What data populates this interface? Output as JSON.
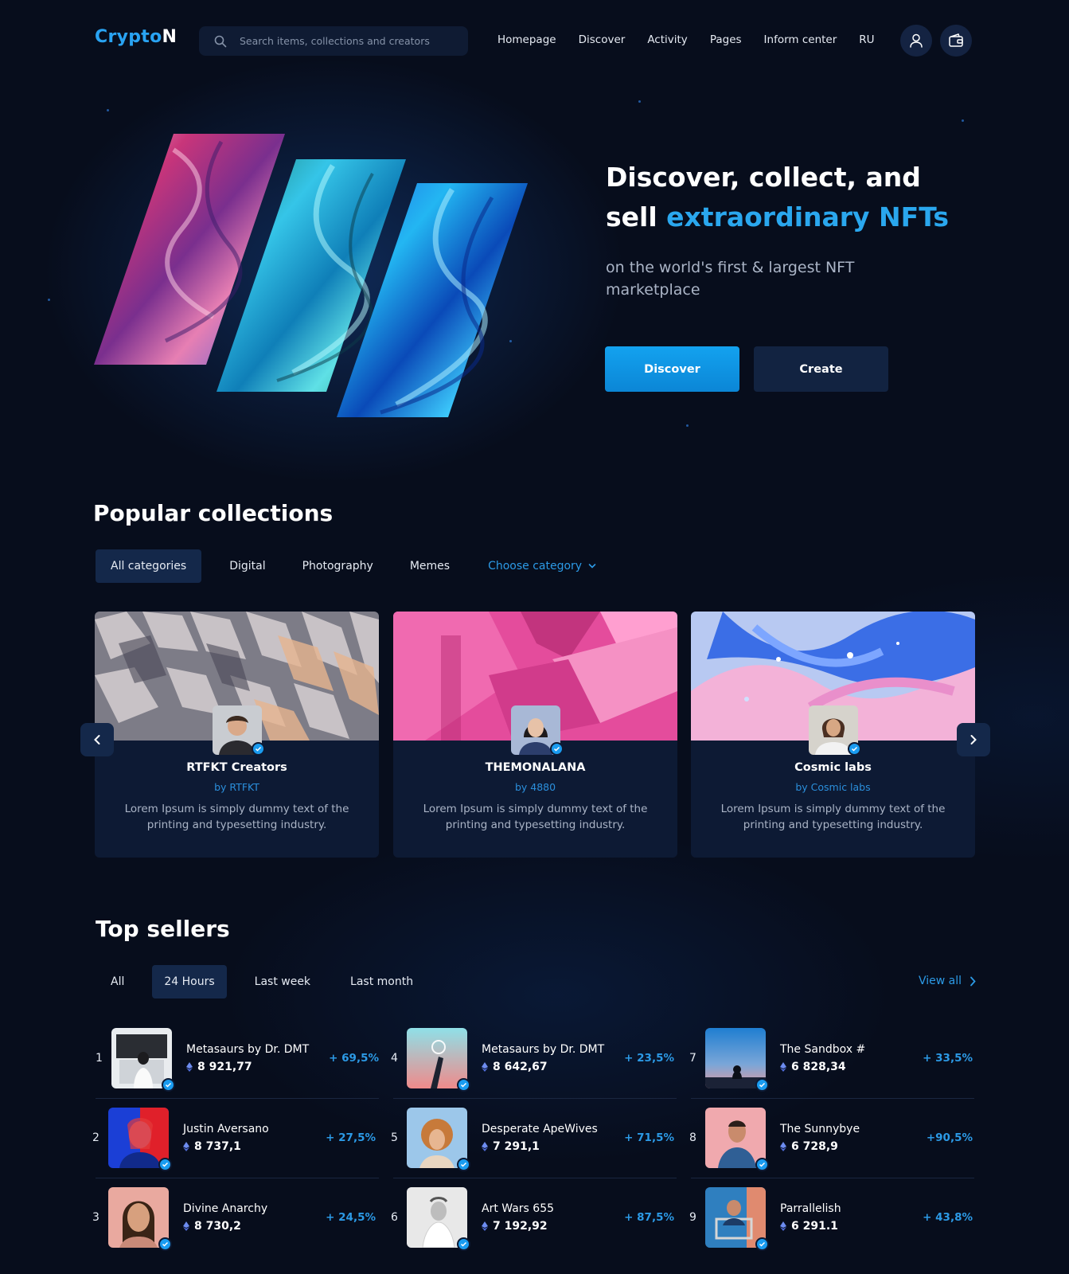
{
  "header": {
    "logo_main": "Crypto",
    "logo_end": "N",
    "search_placeholder": "Search items, collections and creators",
    "nav": [
      "Homepage",
      "Discover",
      "Activity",
      "Pages",
      "Inform center",
      "RU"
    ]
  },
  "hero": {
    "title_line1": "Discover, collect, and",
    "title_line2_plain": "sell ",
    "title_line2_accent": "extraordinary NFTs",
    "subtitle": "on the world's first & largest NFT marketplace",
    "discover_label": "Discover",
    "create_label": "Create"
  },
  "collections": {
    "title": "Popular collections",
    "tabs": [
      "All categories",
      "Digital",
      "Photography",
      "Memes"
    ],
    "choose_category": "Choose category",
    "cards": [
      {
        "name": "RTFKT Creators",
        "by": "by RTFKT",
        "desc": "Lorem Ipsum is simply dummy text of the printing and typesetting industry."
      },
      {
        "name": "THEMONALANA",
        "by": "by 4880",
        "desc": "Lorem Ipsum is simply dummy text of the printing and typesetting industry."
      },
      {
        "name": "Cosmic labs",
        "by": "by Cosmic labs",
        "desc": "Lorem Ipsum is simply dummy text of the printing and typesetting industry."
      }
    ]
  },
  "sellers": {
    "title": "Top sellers",
    "tabs": [
      "All",
      "24 Hours",
      "Last week",
      "Last month"
    ],
    "view_all": "View all",
    "items": [
      {
        "rank": "1",
        "name": "Metasaurs by Dr. DMT",
        "price": "8 921,77",
        "change": "+ 69,5%"
      },
      {
        "rank": "2",
        "name": "Justin Aversano",
        "price": "8 737,1",
        "change": "+ 27,5%"
      },
      {
        "rank": "3",
        "name": "Divine Anarchy",
        "price": "8 730,2",
        "change": "+ 24,5%"
      },
      {
        "rank": "4",
        "name": "Metasaurs by Dr. DMT",
        "price": "8 642,67",
        "change": "+ 23,5%"
      },
      {
        "rank": "5",
        "name": "Desperate ApeWives",
        "price": "7 291,1",
        "change": "+ 71,5%"
      },
      {
        "rank": "6",
        "name": "Art Wars 655",
        "price": "7 192,92",
        "change": "+ 87,5%"
      },
      {
        "rank": "7",
        "name": "The Sandbox #",
        "price": "6 828,34",
        "change": "+ 33,5%"
      },
      {
        "rank": "8",
        "name": "The Sunnybye",
        "price": "6 728,9",
        "change": "+90,5%"
      },
      {
        "rank": "9",
        "name": "Parrallelish",
        "price": "6 291.1",
        "change": "+ 43,8%"
      }
    ]
  },
  "colors": {
    "accent": "#2aa7ee",
    "background": "#070d1c",
    "panel": "#0d1a34"
  }
}
